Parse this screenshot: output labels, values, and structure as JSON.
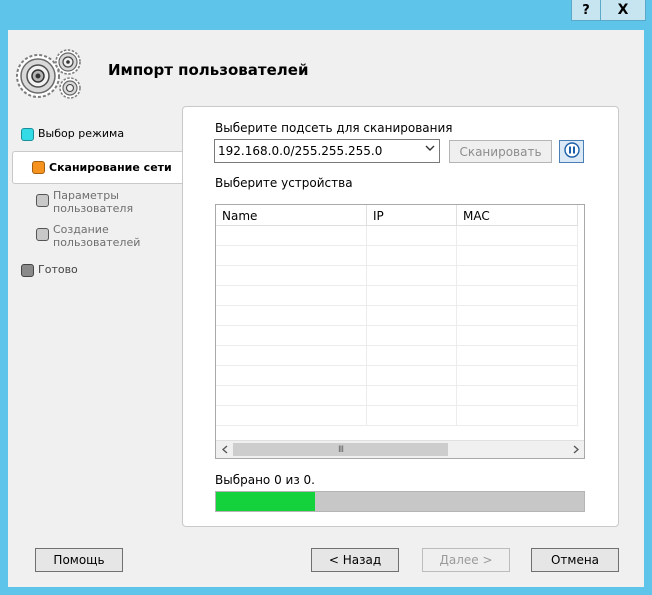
{
  "titlebar": {
    "help_label": "?",
    "close_label": "X"
  },
  "header": {
    "title": "Импорт пользователей",
    "logo_icon": "gears-icon"
  },
  "steps": [
    {
      "label": "Выбор режима",
      "color": "#32dbe6",
      "state": "done"
    },
    {
      "label": "Сканирование сети",
      "color": "#f6921e",
      "state": "current"
    },
    {
      "label": "Параметры\nпользователя",
      "color": "#c8c8c8",
      "state": "pending"
    },
    {
      "label": "Создание\nпользователей",
      "color": "#c8c8c8",
      "state": "pending"
    },
    {
      "label": "Готово",
      "color": "#8a8a8a",
      "state": "pending"
    }
  ],
  "scan": {
    "subnet_label": "Выберите подсеть для сканирования",
    "subnet_value": "192.168.0.0/255.255.255.0",
    "scan_button": "Сканировать",
    "stop_icon": "pause-icon",
    "devices_label": "Выберите устройства"
  },
  "grid": {
    "columns": [
      "Name",
      "IP",
      "MAC"
    ],
    "rows": [],
    "scroll_thumb": "III"
  },
  "status": {
    "selected_text": "Выбрано 0 из 0.",
    "progress_fraction": 0.27,
    "progress_color": "#14d23c"
  },
  "footer": {
    "help": "Помощь",
    "back": "< Назад",
    "next": "Далее >",
    "cancel": "Отмена"
  }
}
